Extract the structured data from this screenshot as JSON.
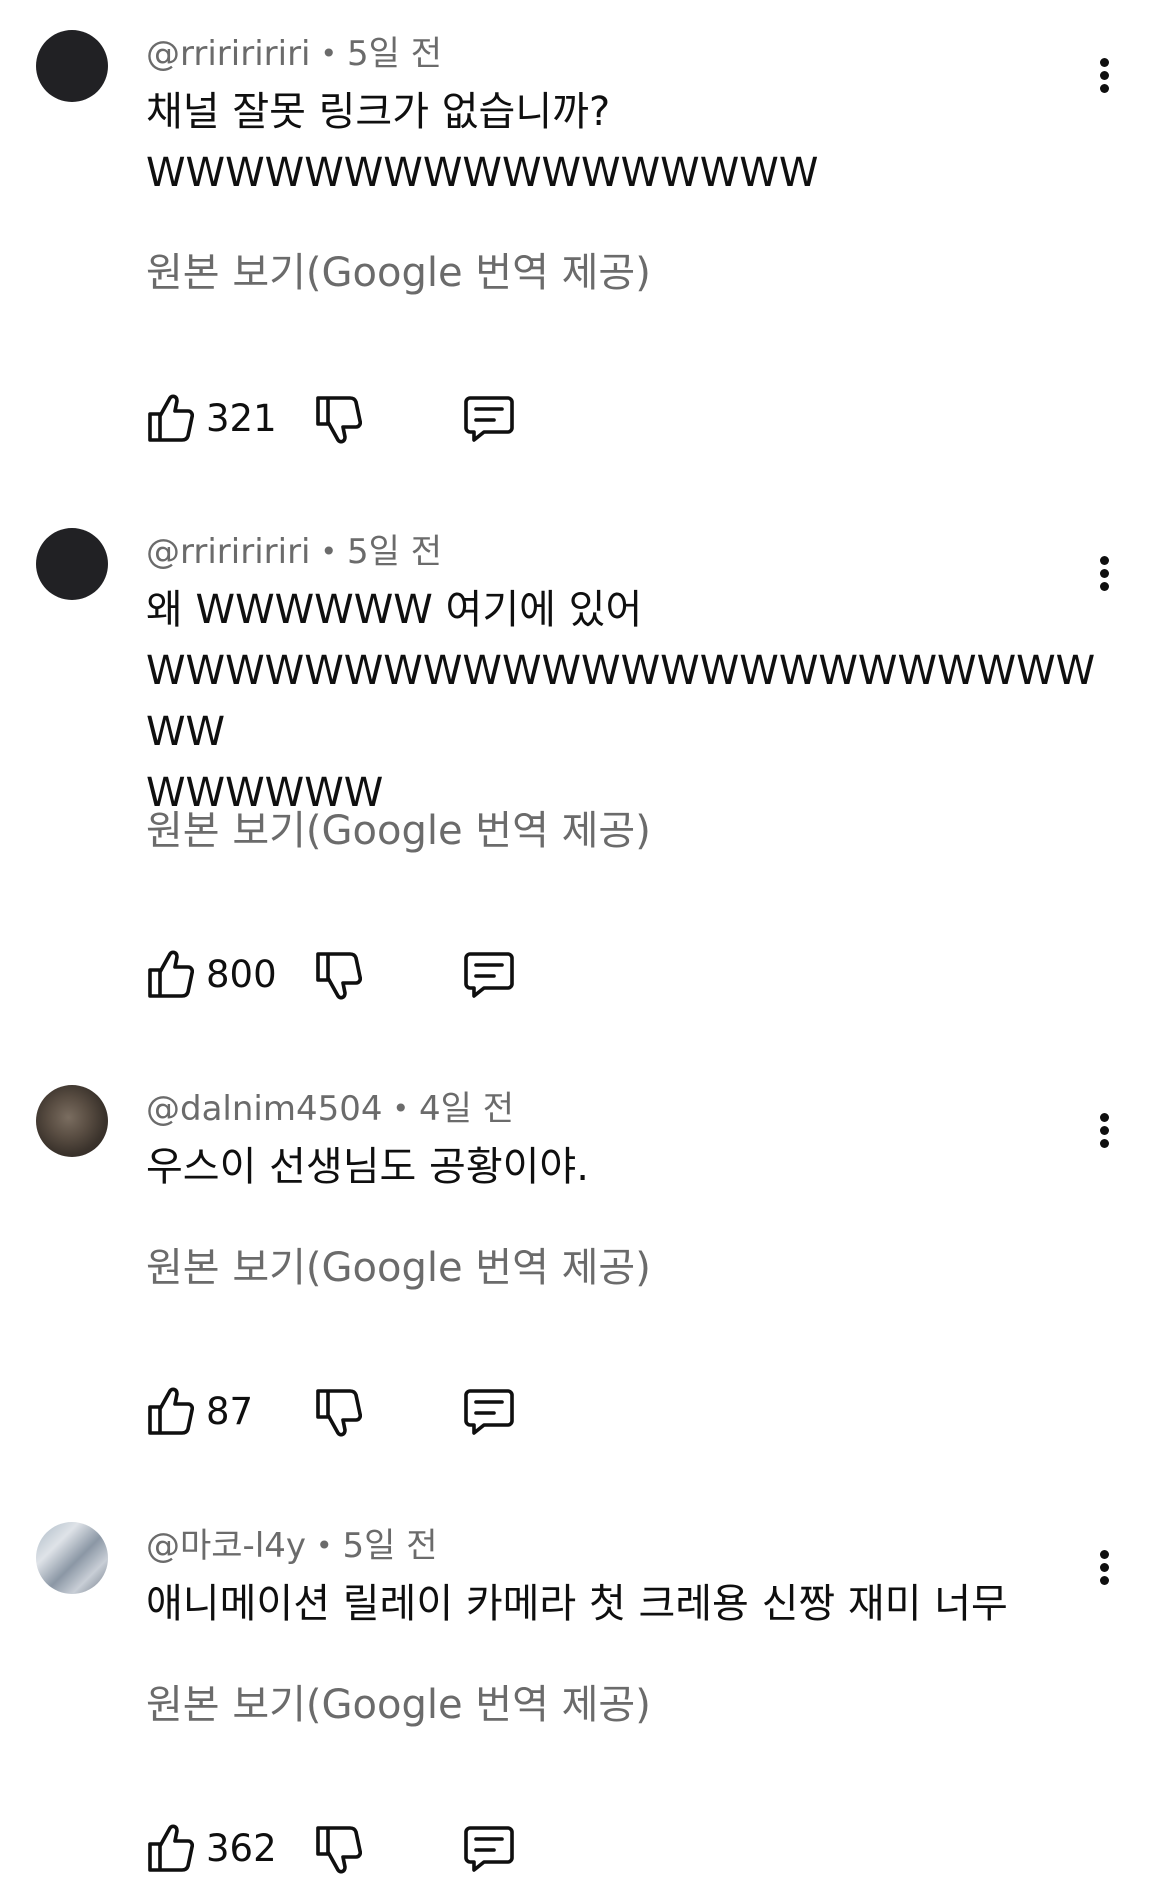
{
  "comments": [
    {
      "handle": "@rririririri",
      "time": "5일 전",
      "lines": [
        "채널 잘못  링크가 없습니까?",
        "WWWWWWWWWWWWWWWWW"
      ],
      "translate_label": "원본 보기(Google 번역 제공)",
      "likes": "321"
    },
    {
      "handle": "@rririririri",
      "time": "5일 전",
      "lines": [
        "왜 WWWWWW 여기에 있어",
        "WWWWWWWWWWWWWWWWWWWWWWWWWW",
        "WWWWWW"
      ],
      "translate_label": "원본 보기(Google 번역 제공)",
      "likes": "800"
    },
    {
      "handle": "@dalnim4504",
      "time": "4일 전",
      "lines": [
        "우스이 선생님도 공황이야."
      ],
      "translate_label": "원본 보기(Google 번역 제공)",
      "likes": "87"
    },
    {
      "handle": "@마코-l4y",
      "time": "5일 전",
      "lines": [
        "애니메이션 릴레이 카메라 첫 크레용 신짱 재미 너무"
      ],
      "translate_label": "원본 보기(Google 번역 제공)",
      "likes": "362"
    }
  ],
  "icons": {
    "like": "thumbs-up-icon",
    "dislike": "thumbs-down-icon",
    "reply": "comment-reply-icon",
    "more": "more-vertical-icon"
  },
  "colors": {
    "text_primary": "#0f0f0f",
    "text_secondary": "#6b6b6b",
    "background": "#ffffff"
  }
}
